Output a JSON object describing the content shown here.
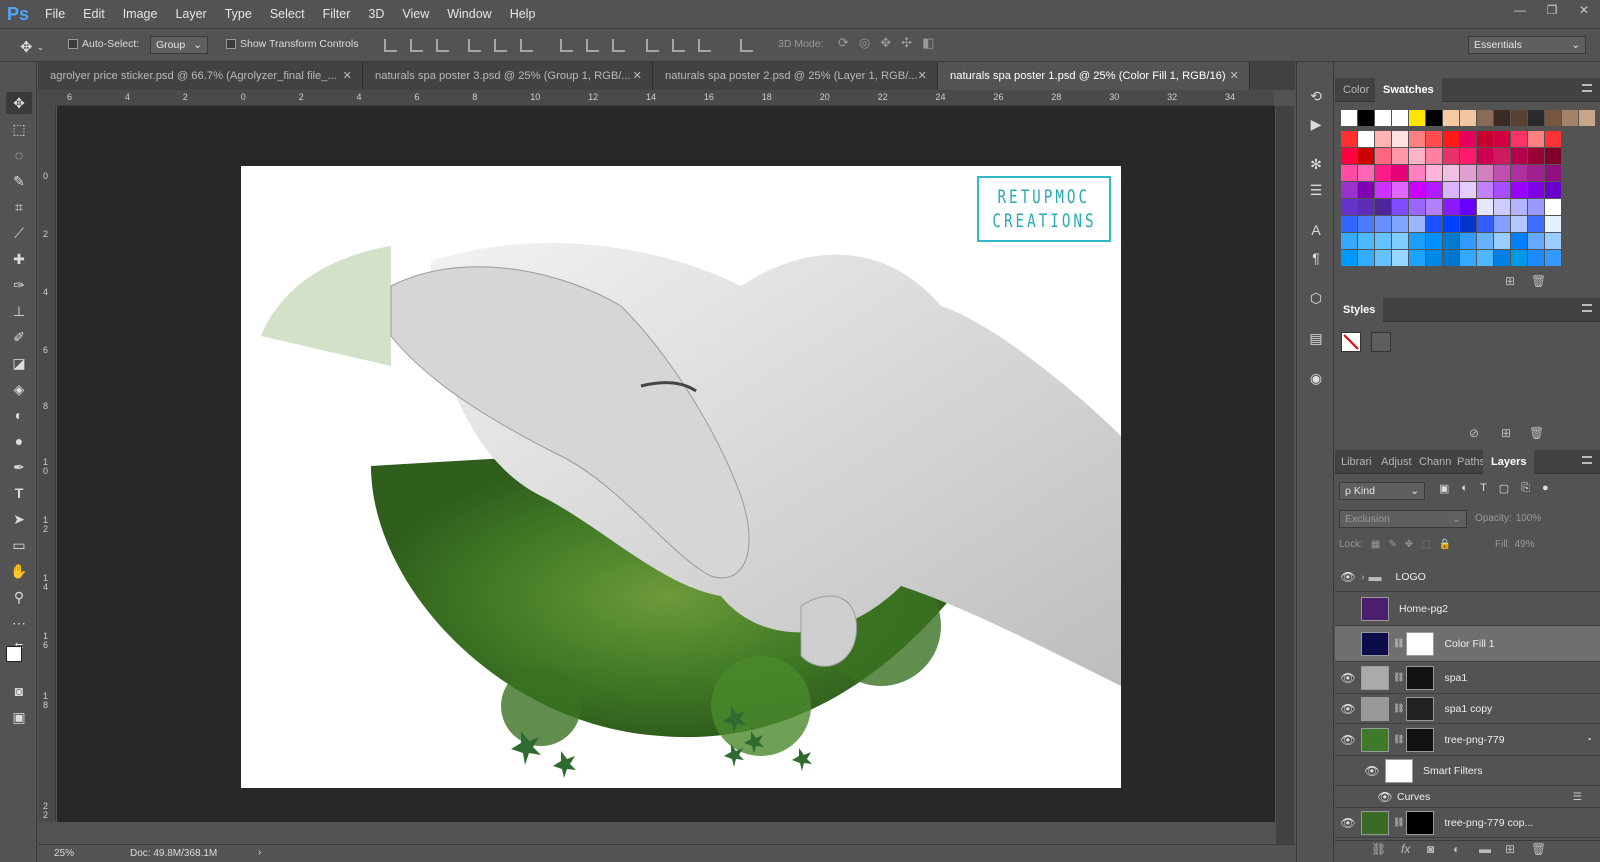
{
  "app": {
    "logo": "Ps"
  },
  "menu": [
    "File",
    "Edit",
    "Image",
    "Layer",
    "Type",
    "Select",
    "Filter",
    "3D",
    "View",
    "Window",
    "Help"
  ],
  "window_controls": [
    "—",
    "❐",
    "✕"
  ],
  "options": {
    "auto_select_label": "Auto-Select:",
    "auto_select_value": "Group",
    "show_transform_label": "Show Transform Controls",
    "mode_3d_label": "3D Mode:",
    "workspace": "Essentials"
  },
  "tabs": [
    {
      "label": "agrolyer price sticker.psd @ 66.7% (Agrolyzer_final file_...",
      "close": "✕"
    },
    {
      "label": "naturals spa poster 3.psd @ 25% (Group 1, RGB/...",
      "close": "✕"
    },
    {
      "label": "naturals spa poster 2.psd @ 25% (Layer 1, RGB/...",
      "close": "✕"
    },
    {
      "label": "naturals spa poster 1.psd @ 25% (Color Fill 1, RGB/16)",
      "close": "✕"
    }
  ],
  "ruler": {
    "h_ticks": [
      "6",
      "4",
      "2",
      "0",
      "2",
      "4",
      "6",
      "8",
      "10",
      "12",
      "14",
      "16",
      "18",
      "20",
      "22",
      "24",
      "26",
      "28",
      "30",
      "32",
      "34"
    ],
    "v_ticks": [
      "0",
      "2",
      "4",
      "6",
      "8",
      "1 0",
      "1 2",
      "1 4",
      "1 6",
      "1 8",
      "2 2"
    ]
  },
  "canvas": {
    "logo_line1": "RETUPMOC",
    "logo_line2": "CREATIONS"
  },
  "status": {
    "zoom": "25%",
    "doc": "Doc: 49.8M/368.1M",
    "arrow": "›"
  },
  "panels": {
    "color_tab": "Color",
    "swatches_tab": "Swatches",
    "styles_tab": "Styles",
    "lower_tabs": [
      "Librari",
      "Adjust",
      "Chann",
      "Paths",
      "Layers"
    ],
    "kind_label": "ρ Kind",
    "blend_mode": "Exclusion",
    "opacity_label": "Opacity:",
    "opacity_value": "100%",
    "lock_label": "Lock:",
    "fill_label": "Fill:",
    "fill_value": "49%"
  },
  "swatch_colors": [
    [
      "#ffffff",
      "#000000",
      "#ffffff",
      "#ffffff",
      "#ffe600",
      "#000000",
      "#f7c9a0",
      "#f2c6a0",
      "#8a6b57",
      "#3a2b24",
      "#5a4034",
      "#2a2a2a",
      "#7a5540",
      "#a5826a",
      "#c9a58a"
    ],
    [
      "#ff3030",
      "#ffffff",
      "#ffb3b3",
      "#ffe0e0",
      "#ff8080",
      "#ff4d4d",
      "#ff1a1a",
      "#e6005c",
      "#c80030",
      "#d00040",
      "#ff3366",
      "#ff8080",
      "#ff3333"
    ],
    [
      "#ff0040",
      "#cc0000",
      "#ff6680",
      "#ff99aa",
      "#ffb3c6",
      "#ff80a0",
      "#e6336b",
      "#ff1a6b",
      "#cc0050",
      "#d01a60",
      "#b3004a",
      "#990033",
      "#80002a"
    ],
    [
      "#ff4da6",
      "#ff66b3",
      "#ff1a8c",
      "#e6007a",
      "#ff80c0",
      "#ffb3d9",
      "#f0c0e0",
      "#e0a0d0",
      "#d080c0",
      "#c050b0",
      "#b030a0",
      "#a0208f",
      "#901080"
    ],
    [
      "#9933cc",
      "#8000b3",
      "#cc33ff",
      "#e066ff",
      "#cc00ff",
      "#b31aff",
      "#d9b3ff",
      "#e6ccff",
      "#c080ff",
      "#a64dff",
      "#9900ff",
      "#8000e6",
      "#6a00cc"
    ],
    [
      "#6633cc",
      "#5c2eb8",
      "#4d2699",
      "#7f4dff",
      "#9966ff",
      "#b380ff",
      "#8c1aff",
      "#6600ff",
      "#e6e6ff",
      "#ccccff",
      "#b3b3ff",
      "#9999ff",
      "#ffffff"
    ],
    [
      "#3366ff",
      "#4d79ff",
      "#6690ff",
      "#80a3ff",
      "#99b6ff",
      "#1a53ff",
      "#0040ff",
      "#0033cc",
      "#335cff",
      "#809fff",
      "#b3c6ff",
      "#3f6fff",
      "#e6f0ff"
    ],
    [
      "#33aaff",
      "#4db8ff",
      "#66c2ff",
      "#80ccff",
      "#1a9fff",
      "#0090ff",
      "#007acc",
      "#3399ff",
      "#66b2ff",
      "#99ccff",
      "#0080ff",
      "#66aaff",
      "#99ccff"
    ],
    [
      "#0099ff",
      "#33adff",
      "#66c2ff",
      "#99d6ff",
      "#1aa3ff",
      "#0088e6",
      "#0077cc",
      "#33aaff",
      "#4db8ff",
      "#0080e6",
      "#0099e6",
      "#1a8cff",
      "#3399ff"
    ]
  ],
  "layers": [
    {
      "name": "LOGO",
      "eye": "👁",
      "thumb": "#5a5a5a"
    },
    {
      "name": "Home-pg2",
      "eye": "",
      "thumb": "#4b1f6e"
    },
    {
      "name": "Color Fill 1",
      "eye": "",
      "thumb": "#0c0c4a"
    },
    {
      "name": "spa1",
      "eye": "👁",
      "thumb": "#aaaaaa"
    },
    {
      "name": "spa1 copy",
      "eye": "👁",
      "thumb": "#999999"
    },
    {
      "name": "tree-png-779",
      "eye": "👁",
      "thumb": "#3f7a2a"
    },
    {
      "name": "Smart Filters",
      "eye": "👁",
      "thumb": "#ffffff"
    },
    {
      "name": "Curves",
      "eye": "👁",
      "thumb": ""
    },
    {
      "name": "tree-png-779 cop...",
      "eye": "👁",
      "thumb": "#3a6b26"
    }
  ]
}
